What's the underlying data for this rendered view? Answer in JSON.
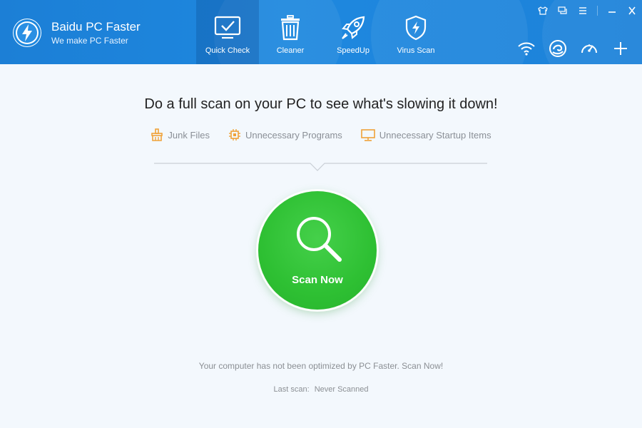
{
  "app": {
    "title": "Baidu PC Faster",
    "subtitle": "We make PC Faster"
  },
  "nav": {
    "items": [
      {
        "label": "Quick Check",
        "icon": "monitor-check-icon",
        "active": true
      },
      {
        "label": "Cleaner",
        "icon": "trash-icon",
        "active": false
      },
      {
        "label": "SpeedUp",
        "icon": "rocket-icon",
        "active": false
      },
      {
        "label": "Virus Scan",
        "icon": "shield-bolt-icon",
        "active": false
      }
    ]
  },
  "window_controls": [
    "skin-icon",
    "feedback-icon",
    "menu-icon",
    "minimize-icon",
    "close-icon"
  ],
  "tools": [
    "wifi-icon",
    "cleaner-swirl-icon",
    "speedometer-icon",
    "plus-icon"
  ],
  "main": {
    "headline": "Do a full scan on your PC to see what's slowing it down!",
    "features": [
      {
        "label": "Junk Files",
        "icon": "broom-icon"
      },
      {
        "label": "Unnecessary Programs",
        "icon": "chip-icon"
      },
      {
        "label": "Unnecessary Startup Items",
        "icon": "monitor-icon"
      }
    ],
    "scan_button": "Scan Now",
    "status_message": "Your computer has not been optimized by PC Faster. Scan Now!",
    "last_scan_label": "Last scan:",
    "last_scan_value": "Never Scanned"
  },
  "colors": {
    "header_blue": "#1e88df",
    "scan_green": "#2ec033",
    "feature_orange": "#f0a23a",
    "text_gray": "#8b8f94"
  }
}
